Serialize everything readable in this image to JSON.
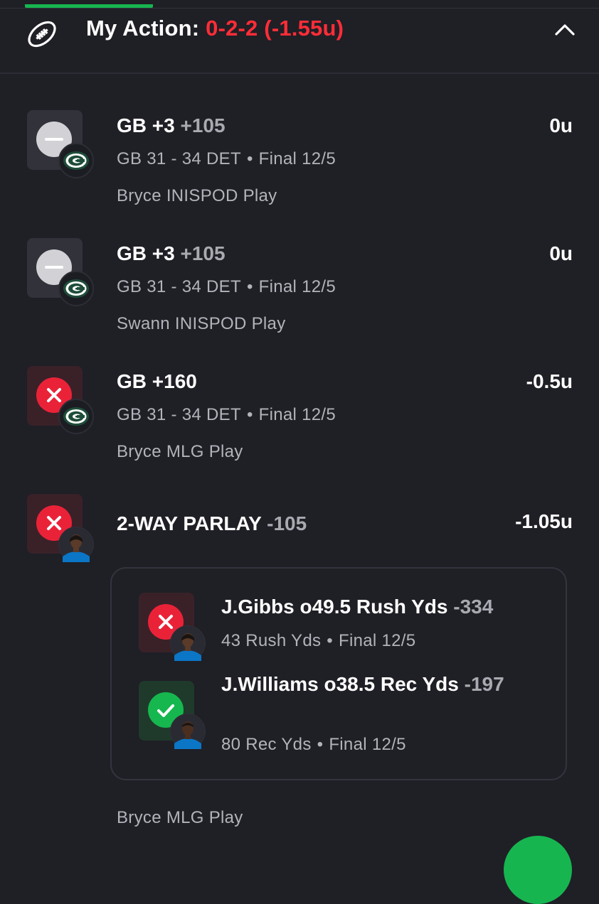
{
  "header": {
    "title": "My Action:",
    "record": "0-2-2 (-1.55u)",
    "icons": {
      "football": "football-icon",
      "collapse": "chevron-up-icon"
    }
  },
  "colors": {
    "background": "#1f1f26",
    "loss": "#ea2238",
    "win": "#16b74f",
    "push": "#d2d2d6",
    "record": "#ff2d37"
  },
  "bets": [
    {
      "title": "GB +3",
      "odds": "+105",
      "result": "0u",
      "score": "GB 31 - 34 DET",
      "status": "Final 12/5",
      "play": "Bryce INISPOD Play",
      "state": "push",
      "logo": "green-bay-logo-icon"
    },
    {
      "title": "GB +3",
      "odds": "+105",
      "result": "0u",
      "score": "GB 31 - 34 DET",
      "status": "Final 12/5",
      "play": "Swann INISPOD Play",
      "state": "push",
      "logo": "green-bay-logo-icon"
    },
    {
      "title": "GB +160",
      "odds": "",
      "result": "-0.5u",
      "score": "GB 31 - 34 DET",
      "status": "Final 12/5",
      "play": "Bryce MLG Play",
      "state": "loss",
      "logo": "green-bay-logo-icon"
    },
    {
      "title": "2-WAY PARLAY",
      "odds": "-105",
      "result": "-1.05u",
      "play": "Bryce MLG Play",
      "state": "loss",
      "logo": "player-headshot-icon",
      "legs": [
        {
          "title": "J.Gibbs o49.5 Rush Yds",
          "odds": "-334",
          "stat": "43 Rush Yds",
          "status": "Final 12/5",
          "state": "loss"
        },
        {
          "title": "J.Williams o38.5 Rec Yds",
          "odds": "-197",
          "stat": "80 Rec Yds",
          "status": "Final 12/5",
          "state": "win"
        }
      ]
    }
  ],
  "dot": "•"
}
